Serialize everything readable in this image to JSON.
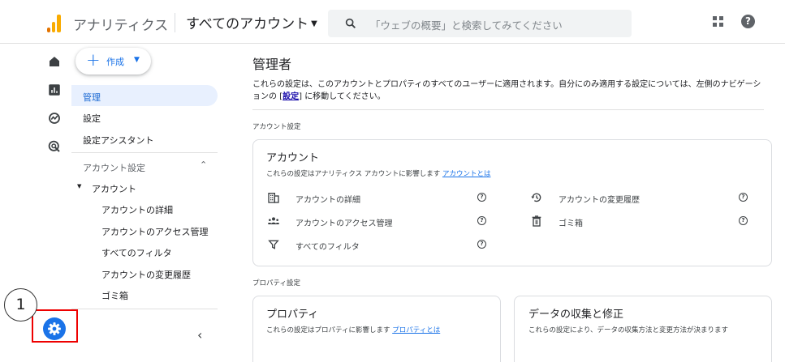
{
  "header": {
    "app_name": "アナリティクス",
    "account_picker": "すべてのアカウント",
    "search_placeholder": "「ウェブの概要」と検索してみてください",
    "icons": [
      "search-icon",
      "apps-grid-icon",
      "help-icon"
    ]
  },
  "rail": {
    "icons": [
      "home-icon",
      "reports-icon",
      "explore-icon",
      "advertising-icon",
      "settings-gear-icon"
    ]
  },
  "sidebar": {
    "create_label": "作成",
    "items": [
      {
        "label": "管理",
        "active": true
      },
      {
        "label": "設定"
      },
      {
        "label": "設定アシスタント"
      }
    ],
    "account_section": {
      "label": "アカウント設定",
      "group": "アカウント",
      "children": [
        "アカウントの詳細",
        "アカウントのアクセス管理",
        "すべてのフィルタ",
        "アカウントの変更履歴",
        "ゴミ箱"
      ]
    }
  },
  "callout": {
    "number": "1",
    "color": "#ee0000"
  },
  "main": {
    "title": "管理者",
    "description": "これらの設定は、このアカウントとプロパティのすべてのユーザーに適用されます。自分にのみ適用する設定については、左側のナビゲーションの",
    "description_link": "設定",
    "description_end": "に移動してください。",
    "account_settings_label": "アカウント設定",
    "account_card": {
      "title": "アカウント",
      "subtitle": "これらの設定はアナリティクス アカウントに影響します",
      "link": "アカウントとは",
      "left_items": [
        "アカウントの詳細",
        "アカウントのアクセス管理",
        "すべてのフィルタ"
      ],
      "right_items": [
        "アカウントの変更履歴",
        "ゴミ箱"
      ]
    },
    "property_settings_label": "プロパティ設定",
    "property_card": {
      "title": "プロパティ",
      "subtitle": "これらの設定はプロパティに影響します",
      "link": "プロパティとは"
    },
    "data_card": {
      "title": "データの収集と修正",
      "subtitle": "これらの設定により、データの収集方法と変更方法が決まります"
    }
  },
  "colors": {
    "accent": "#1a73e8",
    "active_bg": "#e8f0fe",
    "highlight": "#ee0000",
    "logo": [
      "#f9ab00",
      "#e37400"
    ]
  }
}
